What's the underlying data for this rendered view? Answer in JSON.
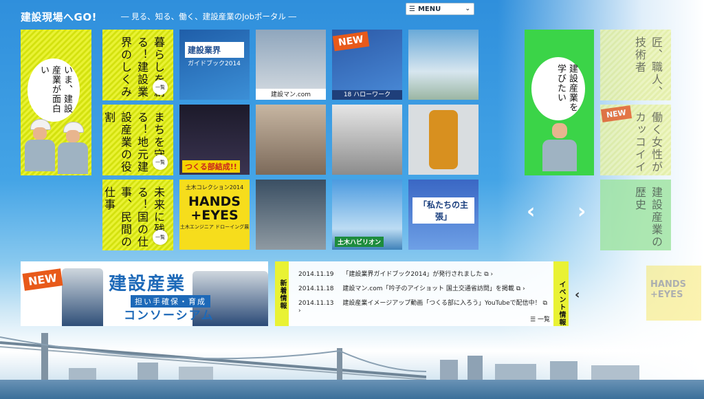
{
  "header": {
    "title": "建設現場へGO!",
    "subtitle": "― 見る、知る、働く、建設産業のJobポータル ―",
    "menu_label": "MENU"
  },
  "colors": {
    "accent_yellow": "#e9f234",
    "accent_green": "#3bd448",
    "sky_blue": "#2f8fdc",
    "brand_blue": "#1d69b8"
  },
  "left_feature": {
    "bubble_text": "いま、建設産業が面白い"
  },
  "category_tiles": [
    {
      "text": "暮らしを創る！建設業界のしくみ",
      "more": "一覧"
    },
    {
      "text": "まちを守る！地元建設産業の役割",
      "more": "一覧"
    },
    {
      "text": "未来に残る！国の仕事、民間の仕事",
      "more": "一覧"
    }
  ],
  "photo_tiles": {
    "guidebook": {
      "title": "建設業界",
      "subtitle": "ガイドブック2014"
    },
    "kensetsuman": {
      "caption": "建設マン.com"
    },
    "hellowork": {
      "badge": "NEW",
      "caption": "18 ハローワーク"
    },
    "tsukurubu": {
      "tag": "つくる部結成!!"
    },
    "hands_eyes": {
      "caption1": "土木コレクション2014",
      "title": "HANDS\n+EYES",
      "caption2": "土木エンジニア ドローイング展"
    },
    "doboku": {
      "label": "土木ハビリオン"
    },
    "poster": {
      "title": "「私たちの主張」"
    }
  },
  "right_feature": {
    "bubble_text": "建設産業を学びたい",
    "tiles": [
      {
        "text": "匠、職人、技術者"
      },
      {
        "text": "働く女性がカッコイイ",
        "badge": "NEW"
      },
      {
        "text": "建設産業の歴史"
      }
    ]
  },
  "carousel": {
    "prev_icon": "‹",
    "next_icon": "›"
  },
  "banner": {
    "badge": "NEW",
    "title": "建設産業",
    "subtitle1": "担い手確保・育成",
    "subtitle2": "コンソーシアム"
  },
  "news": {
    "section_label": "新着情報",
    "items": [
      {
        "date": "2014.11.19",
        "text": "「建設業界ガイドブック2014」が発行されました"
      },
      {
        "date": "2014.11.18",
        "text": "建設マン.com「吟子のアイショット 国土交通省訪問」を掲載"
      },
      {
        "date": "2014.11.13",
        "text": "建設産業イメージアップ動画「つくる部に入ろう」YouTubeで配信中！"
      }
    ],
    "more_label": "一覧"
  },
  "events": {
    "section_label": "イベント情報",
    "arrow": "‹",
    "ghost_title": "HANDS\n+EYES"
  }
}
